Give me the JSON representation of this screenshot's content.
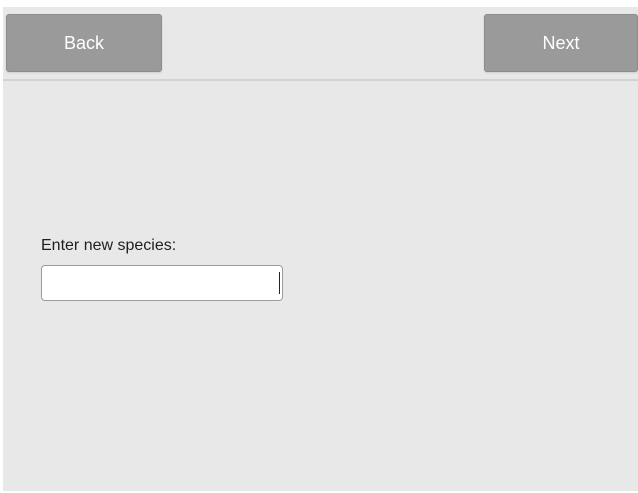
{
  "toolbar": {
    "back_label": "Back",
    "next_label": "Next"
  },
  "form": {
    "prompt_label": "Enter new species:",
    "species_value": "",
    "species_placeholder": ""
  }
}
